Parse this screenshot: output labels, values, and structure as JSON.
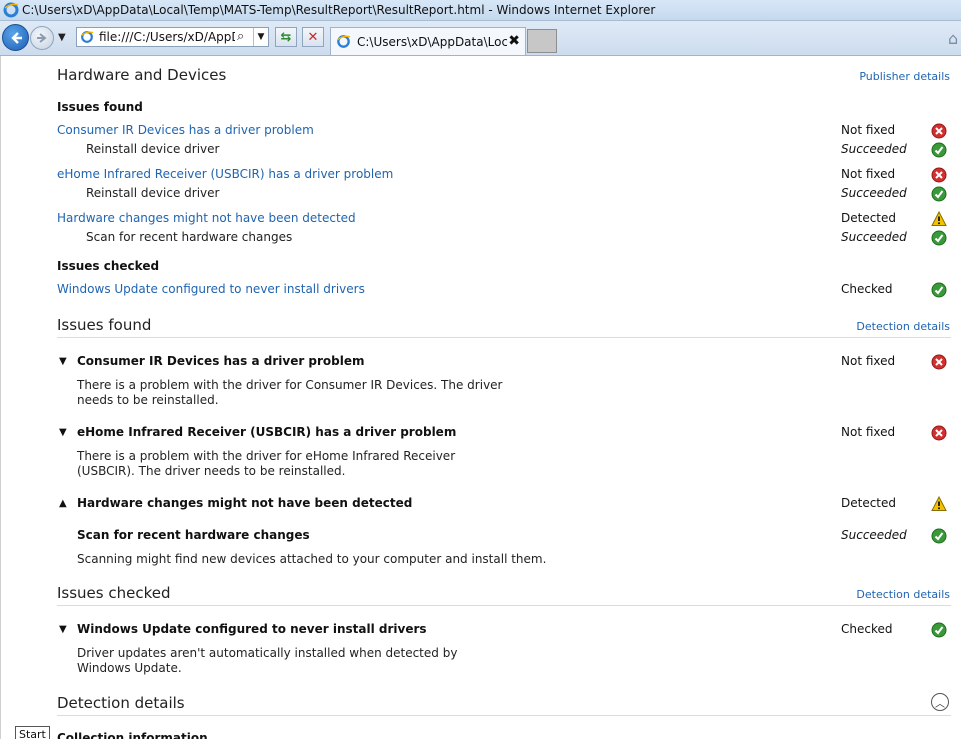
{
  "window": {
    "title": "C:\\Users\\xD\\AppData\\Local\\Temp\\MATS-Temp\\ResultReport\\ResultReport.html - Windows Internet Explorer"
  },
  "toolbar": {
    "address": "file:///C:/Users/xD/AppData",
    "tab_label": "C:\\Users\\xD\\AppData\\Loc...",
    "tab_close": "✖"
  },
  "hardware_section": {
    "title": "Hardware and Devices",
    "publisher_link": "Publisher details",
    "issues_found_label": "Issues found",
    "issues": [
      {
        "title": "Consumer IR Devices has a driver problem",
        "status": "Not fixed",
        "status_icon": "error-icon",
        "action": "Reinstall device driver",
        "action_status": "Succeeded",
        "action_icon": "success-icon"
      },
      {
        "title": "eHome Infrared Receiver (USBCIR) has a driver problem",
        "status": "Not fixed",
        "status_icon": "error-icon",
        "action": "Reinstall device driver",
        "action_status": "Succeeded",
        "action_icon": "success-icon"
      },
      {
        "title": "Hardware changes might not have been detected",
        "status": "Detected",
        "status_icon": "warning-icon",
        "action": "Scan for recent hardware changes",
        "action_status": "Succeeded",
        "action_icon": "success-icon"
      }
    ],
    "issues_checked_label": "Issues checked",
    "checked": [
      {
        "title": "Windows Update configured to never install drivers",
        "status": "Checked",
        "status_icon": "success-icon"
      }
    ]
  },
  "issues_found_section": {
    "title": "Issues found",
    "detection_link": "Detection details",
    "items": [
      {
        "title": "Consumer IR Devices has a driver problem",
        "status": "Not fixed",
        "description": "There is a problem with the driver for Consumer IR Devices. The driver needs to be reinstalled."
      },
      {
        "title": "eHome Infrared Receiver (USBCIR) has a driver problem",
        "status": "Not fixed",
        "description": "There is a problem with the driver for eHome Infrared Receiver (USBCIR). The driver needs to be reinstalled."
      },
      {
        "title": "Hardware changes might not have been detected",
        "status": "Detected",
        "sub_title": "Scan for recent hardware changes",
        "sub_status": "Succeeded",
        "description": "Scanning might find new devices attached to your computer and install them."
      }
    ]
  },
  "issues_checked_section": {
    "title": "Issues checked",
    "detection_link": "Detection details",
    "items": [
      {
        "title": "Windows Update configured to never install drivers",
        "status": "Checked",
        "description": "Driver updates aren't automatically installed when detected by Windows Update."
      }
    ]
  },
  "detection_section": {
    "title": "Detection details",
    "collection_info": "Collection information"
  },
  "taskbar": {
    "start_label": "Start"
  },
  "colors": {
    "link": "#1f64b0",
    "error": "#d32f2f",
    "success": "#3a9a3a",
    "warning": "#f2c200"
  }
}
